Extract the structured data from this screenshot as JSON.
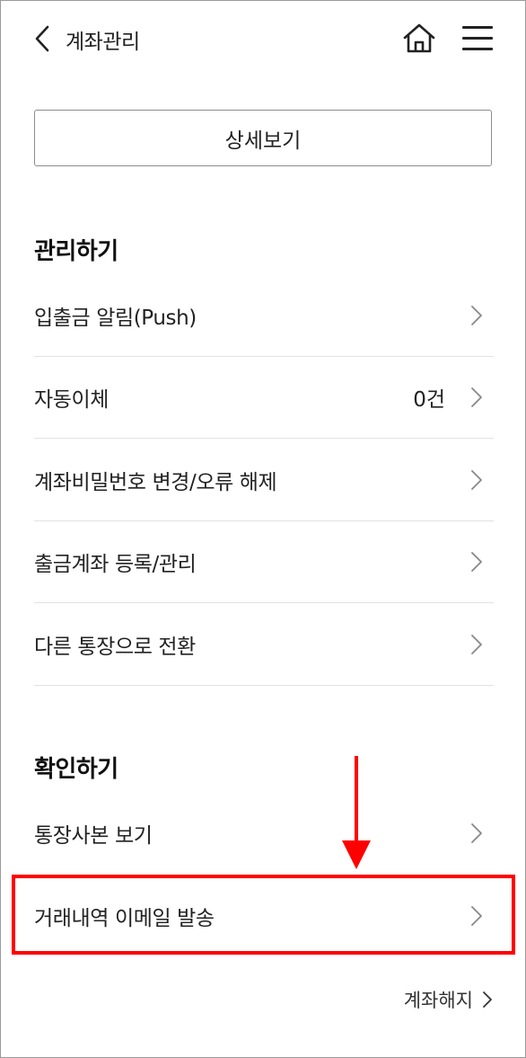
{
  "header": {
    "title": "계좌관리",
    "back_icon": "chevron-left-icon",
    "home_icon": "home-icon",
    "menu_icon": "hamburger-menu-icon"
  },
  "peek": {
    "left_text": "",
    "right_text": ""
  },
  "detail_button": {
    "label": "상세보기"
  },
  "manage": {
    "title": "관리하기",
    "items": [
      {
        "label": "입출금 알림(Push)"
      },
      {
        "label": "자동이체",
        "value": "0건"
      },
      {
        "label": "계좌비밀번호 변경/오류 해제"
      },
      {
        "label": "출금계좌 등록/관리"
      },
      {
        "label": "다른 통장으로 전환"
      }
    ]
  },
  "confirm": {
    "title": "확인하기",
    "items": [
      {
        "label": "통장사본 보기"
      },
      {
        "label": "거래내역 이메일 발송"
      }
    ]
  },
  "footer": {
    "close_account_label": "계좌해지"
  },
  "colors": {
    "accent_red": "#ff0000",
    "dot_red": "#e8242a",
    "divider": "#e2e2e2"
  }
}
